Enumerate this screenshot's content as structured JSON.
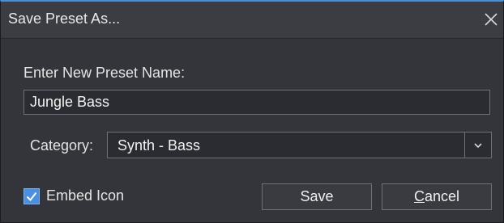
{
  "dialog": {
    "title": "Save Preset As...",
    "close_icon": "close-icon"
  },
  "name_field": {
    "label": "Enter New Preset Name:",
    "value": "Jungle Bass"
  },
  "category": {
    "label": "Category:",
    "selected": "Synth - Bass",
    "dropdown_icon": "chevron-down-icon"
  },
  "embed_icon": {
    "label": "Embed Icon",
    "checked": true
  },
  "buttons": {
    "save_label": "Save",
    "cancel_label": "Cancel"
  },
  "colors": {
    "accent": "#4a90e2",
    "background": "#34353b",
    "titlebar": "#3c3d43",
    "field": "#2b2c31"
  }
}
